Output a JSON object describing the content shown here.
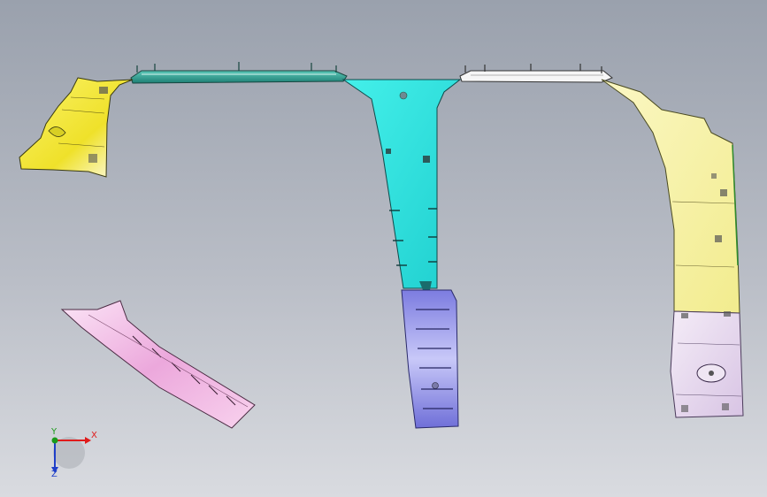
{
  "viewport": {
    "background_top": "#9aa1ad",
    "background_bottom": "#d9dbe0"
  },
  "parts": [
    {
      "name": "a-pillar-upper-trim",
      "color": "#f2e63a"
    },
    {
      "name": "roof-rail-front",
      "color": "#2a9e90"
    },
    {
      "name": "b-pillar-upper-trim",
      "color": "#33e6e0"
    },
    {
      "name": "b-pillar-lower-trim",
      "color": "#8f8ee8"
    },
    {
      "name": "roof-rail-rear",
      "color": "#f4f4f4"
    },
    {
      "name": "c-pillar-upper-trim",
      "color": "#f7f3a2"
    },
    {
      "name": "c-pillar-lower-trim",
      "color": "#e8d8ee"
    },
    {
      "name": "a-pillar-lower-trim",
      "color": "#f0b6e2"
    }
  ],
  "axis_triad": {
    "x_label": "X",
    "y_label": "Y",
    "z_label": "Z",
    "x_color": "#e01b1b",
    "y_color": "#1a9a1a",
    "z_color": "#1f3fc9"
  }
}
